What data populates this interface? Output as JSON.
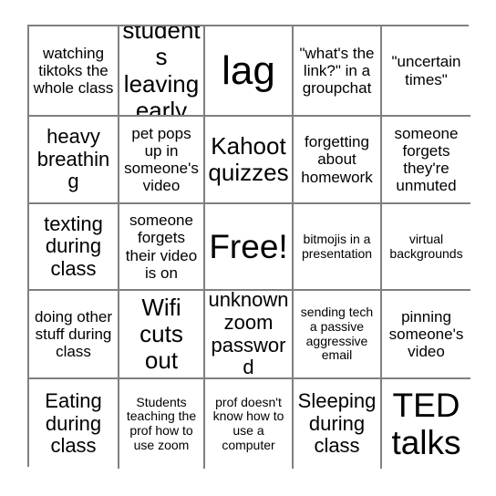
{
  "card": {
    "type": "bingo-card",
    "columns": 5,
    "rows": 5,
    "border_color": "#808080",
    "background_color": "#ffffff",
    "text_color": "#000000",
    "free_space_index": 12,
    "cells": [
      {
        "label": "watching tiktoks the whole class",
        "size": "sm"
      },
      {
        "label": "students leaving early",
        "size": "lg"
      },
      {
        "label": "lag",
        "size": "xxl"
      },
      {
        "label": "\"what's the link?\" in a groupchat",
        "size": "sm"
      },
      {
        "label": "\"uncertain times\"",
        "size": "sm"
      },
      {
        "label": "heavy breathing",
        "size": "md"
      },
      {
        "label": "pet pops up in someone's video",
        "size": "sm"
      },
      {
        "label": "Kahoot quizzes",
        "size": "lg"
      },
      {
        "label": "forgetting about homework",
        "size": "sm"
      },
      {
        "label": "someone forgets they're unmuted",
        "size": "sm"
      },
      {
        "label": "texting during class",
        "size": "md"
      },
      {
        "label": "someone forgets their video is on",
        "size": "sm"
      },
      {
        "label": "Free!",
        "size": "xl"
      },
      {
        "label": "bitmojis in a presentation",
        "size": "xs"
      },
      {
        "label": "virtual backgrounds",
        "size": "xs"
      },
      {
        "label": "doing other stuff during class",
        "size": "sm"
      },
      {
        "label": "Wifi cuts out",
        "size": "lg"
      },
      {
        "label": "unknown zoom password",
        "size": "md"
      },
      {
        "label": "sending tech a passive aggressive email",
        "size": "xs"
      },
      {
        "label": "pinning someone's video",
        "size": "sm"
      },
      {
        "label": "Eating during class",
        "size": "md"
      },
      {
        "label": "Students teaching the prof how to use zoom",
        "size": "xs"
      },
      {
        "label": "prof doesn't know how to use a computer",
        "size": "xs"
      },
      {
        "label": "Sleeping during class",
        "size": "md"
      },
      {
        "label": "TED talks",
        "size": "xl"
      }
    ]
  }
}
